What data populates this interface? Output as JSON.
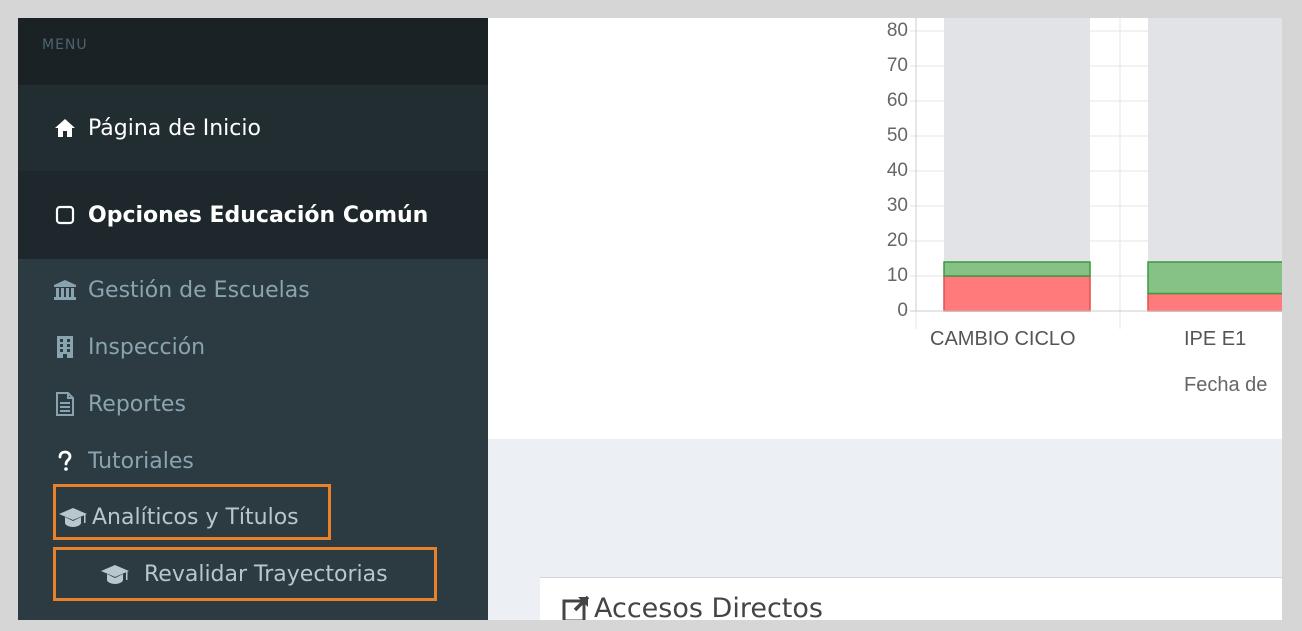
{
  "sidebar": {
    "header": "MENU",
    "home": {
      "label": "Página de Inicio",
      "icon": "home-icon"
    },
    "opciones": {
      "label": "Opciones Educación Común",
      "icon": "square-icon"
    },
    "items": [
      {
        "label": "Gestión de Escuelas",
        "icon": "bank-icon"
      },
      {
        "label": "Inspección",
        "icon": "building-icon"
      },
      {
        "label": "Reportes",
        "icon": "file-text-icon"
      },
      {
        "label": "Tutoriales",
        "icon": "question-icon"
      },
      {
        "label": "Analíticos y Títulos",
        "icon": "graduation-cap-icon"
      },
      {
        "label": "Revalidar Trayectorias",
        "icon": "graduation-cap-icon"
      }
    ]
  },
  "colors": {
    "highlight": "#e8822a",
    "green_series": "#86c286",
    "red_series": "#ff7b7b"
  },
  "chart_data": {
    "type": "bar",
    "stacked": true,
    "categories": [
      "CAMBIO CICLO",
      "IPE E1"
    ],
    "series": [
      {
        "values": [
          10,
          5
        ],
        "color": "#ff7b7b"
      },
      {
        "values": [
          4,
          9
        ],
        "color": "#86c286"
      }
    ],
    "y_ticks": [
      "0",
      "10",
      "20",
      "30",
      "40",
      "50",
      "60",
      "70",
      "80"
    ],
    "ylim": [
      0,
      80
    ],
    "xlabel": "Fecha de",
    "grid": true
  },
  "accesos": {
    "title": "Accesos Directos",
    "icon": "external-link-icon"
  }
}
